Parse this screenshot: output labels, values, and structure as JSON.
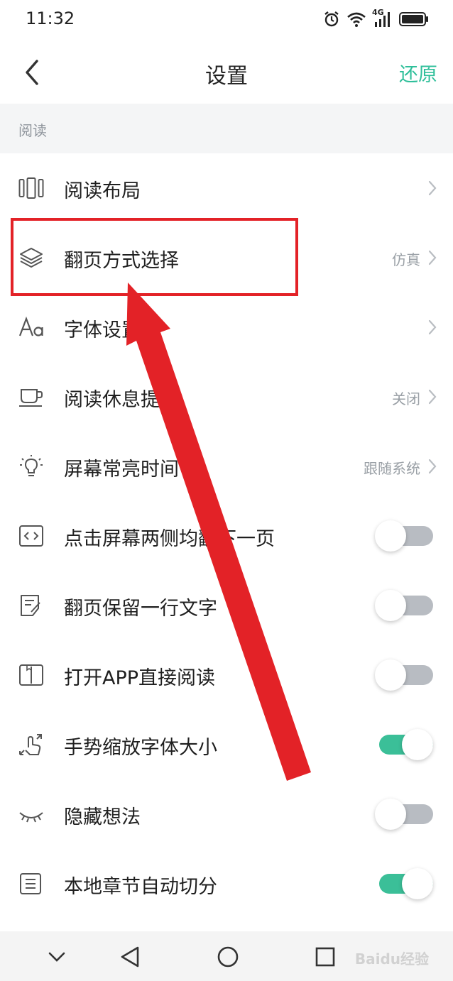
{
  "status_bar": {
    "time": "11:32",
    "network": "4G",
    "icons": [
      "alarm-icon",
      "wifi-icon",
      "signal-icon",
      "battery-icon"
    ]
  },
  "header": {
    "title": "设置",
    "restore_label": "还原",
    "back_icon": "chevron-left-icon"
  },
  "section": {
    "label": "阅读"
  },
  "items": [
    {
      "label": "阅读布局",
      "icon": "layout-icon",
      "type": "chevron"
    },
    {
      "label": "翻页方式选择",
      "icon": "layers-icon",
      "type": "chevron",
      "value": "仿真"
    },
    {
      "label": "字体设置",
      "icon": "font-icon",
      "type": "chevron"
    },
    {
      "label": "阅读休息提醒",
      "icon": "cup-icon",
      "type": "chevron",
      "value": "关闭"
    },
    {
      "label": "屏幕常亮时间",
      "icon": "lightbulb-icon",
      "type": "chevron",
      "value": "跟随系统"
    },
    {
      "label": "点击屏幕两侧均翻下一页",
      "icon": "code-brackets-icon",
      "type": "toggle",
      "on": false
    },
    {
      "label": "翻页保留一行文字",
      "icon": "note-icon",
      "type": "toggle",
      "on": false
    },
    {
      "label": "打开APP直接阅读",
      "icon": "book-icon",
      "type": "toggle",
      "on": false
    },
    {
      "label": "手势缩放字体大小",
      "icon": "gesture-icon",
      "type": "toggle",
      "on": true
    },
    {
      "label": "隐藏想法",
      "icon": "eye-closed-icon",
      "type": "toggle",
      "on": false
    },
    {
      "label": "本地章节自动切分",
      "icon": "list-icon",
      "type": "toggle",
      "on": true
    }
  ],
  "bottom_nav": {
    "icons": [
      "chevron-down-icon",
      "back-triangle-icon",
      "home-circle-icon",
      "recents-square-icon"
    ]
  },
  "watermark": "Baidu经验",
  "colors": {
    "accent": "#2fbf9a",
    "annotation": "#e32227",
    "section_bg": "#f4f5f6"
  }
}
